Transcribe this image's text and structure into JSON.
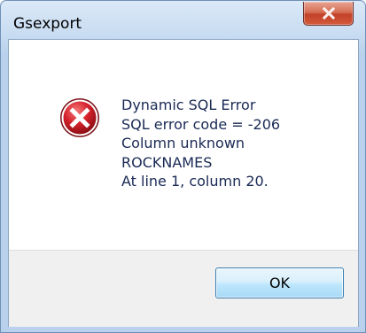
{
  "window": {
    "title": "Gsexport"
  },
  "icons": {
    "close": "close-icon",
    "error": "error-icon"
  },
  "message": {
    "lines": [
      "Dynamic SQL Error",
      "SQL error code = -206",
      "Column unknown",
      "ROCKNAMES",
      "At line 1, column 20."
    ]
  },
  "buttons": {
    "ok_label": "OK"
  },
  "colors": {
    "error_red": "#d4202a",
    "close_button_red": "#c2412a",
    "ok_button_border": "#3c7fb1",
    "message_text": "#1a2a55"
  }
}
